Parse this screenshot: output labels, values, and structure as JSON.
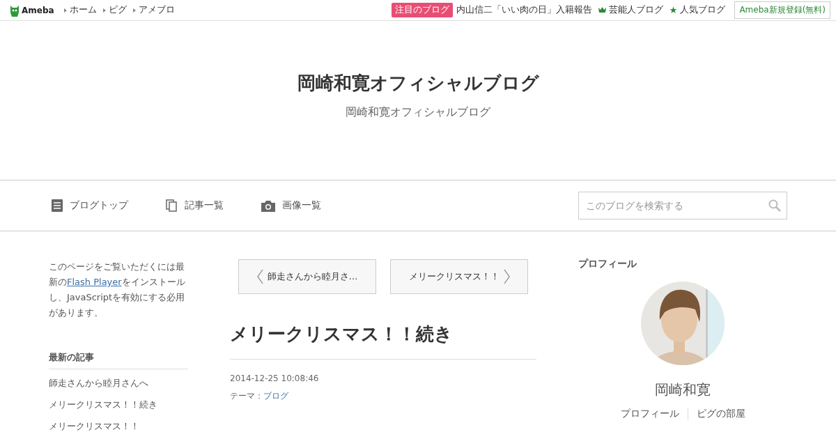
{
  "topbar": {
    "logo": "Ameba",
    "links": [
      "ホーム",
      "ピグ",
      "アメブロ"
    ],
    "featured_badge": "注目のブログ",
    "featured_text": "内山信二「いい肉の日」入籍報告",
    "ranking_links": [
      {
        "kind": "crown",
        "label": "芸能人ブログ"
      },
      {
        "kind": "star",
        "label": "人気ブログ"
      }
    ],
    "signup_button": "Ameba新規登録(無料)"
  },
  "header": {
    "title": "岡崎和寛オフィシャルブログ",
    "subtitle": "岡崎和寛オフィシャルブログ"
  },
  "nav": {
    "items": [
      {
        "kind": "doc",
        "label": "ブログトップ"
      },
      {
        "kind": "copy",
        "label": "記事一覧"
      },
      {
        "kind": "camera",
        "label": "画像一覧"
      }
    ],
    "search": {
      "placeholder": "このブログを検索する"
    }
  },
  "left": {
    "notice": [
      "このページをご覧いただくには最新の",
      "Flash Player",
      "をインストールし、JavaScriptを有効にする必用があります。"
    ],
    "recent_title": "最新の記事",
    "recent": [
      "師走さんから睦月さんへ",
      "メリークリスマス！！続き",
      "メリークリスマス！！"
    ]
  },
  "article": {
    "prev": "師走さんから睦月さ…",
    "next": "メリークリスマス！！",
    "title": "メリークリスマス！！続き",
    "date": "2014-12-25 10:08:46",
    "theme_label": "テーマ：",
    "theme": "ブログ"
  },
  "profile": {
    "heading": "プロフィール",
    "avatar": {
      "kind": "picture"
    },
    "name": "岡崎和寛",
    "links": [
      "プロフィール",
      "ピグの部屋"
    ]
  }
}
